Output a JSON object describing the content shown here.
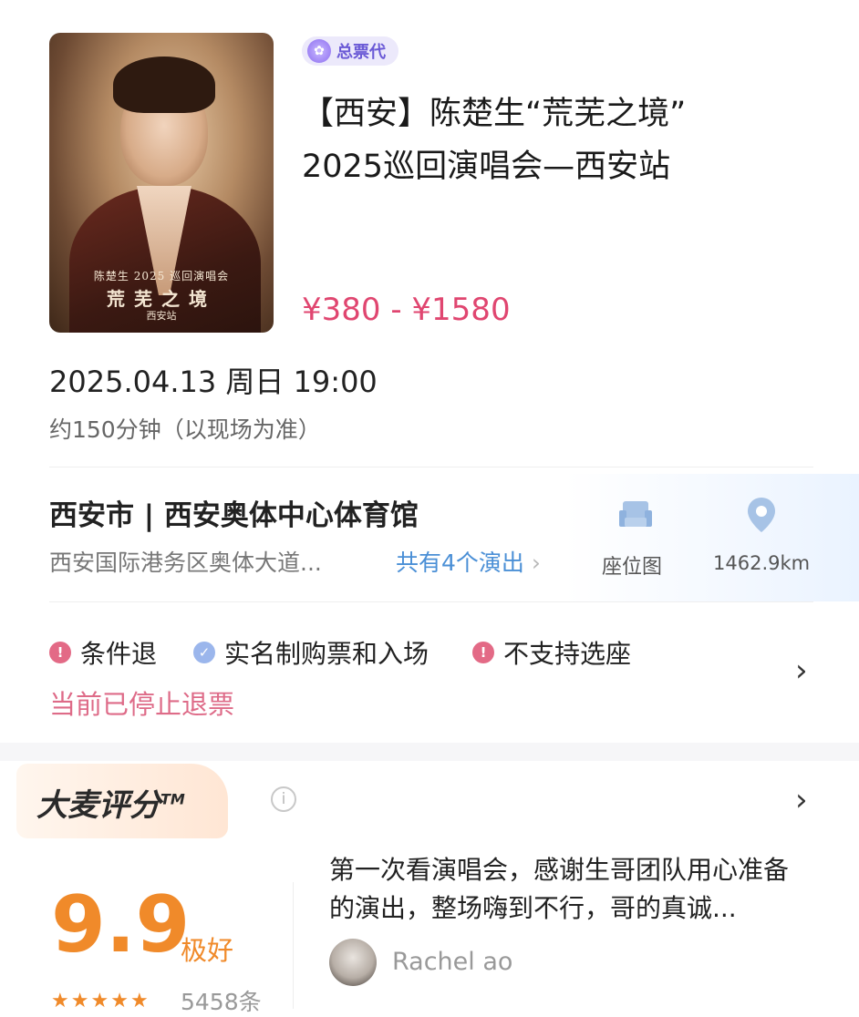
{
  "event": {
    "badge": "总票代",
    "title_line1": "【西安】陈楚生“荒芜之境”",
    "title_line2": "2025巡回演唱会—西安站",
    "price": "¥380 - ¥1580",
    "date": "2025.04.13 周日 19:00",
    "duration": "约150分钟（以现场为准）",
    "poster": {
      "line1": "陈楚生 2025 巡回演唱会",
      "line2": "荒芜之境",
      "line3": "西安站"
    }
  },
  "venue": {
    "title": "西安市 | 西安奥体中心体育馆",
    "address": "西安国际港务区奥体大道...",
    "shows_link": "共有4个演出",
    "seat_map_label": "座位图",
    "distance": "1462.9km"
  },
  "policies": [
    {
      "label": "条件退",
      "icon": "exclamation-icon"
    },
    {
      "label": "实名制购票和入场",
      "icon": "check-icon"
    },
    {
      "label": "不支持选座",
      "icon": "exclamation-icon"
    }
  ],
  "refund_note": "当前已停止退票",
  "rating": {
    "brand": "大麦评分",
    "tm": "TM",
    "score": "9.9",
    "score_label": "极好",
    "stars": 4.5,
    "count": "5458条",
    "review_text": "第一次看演唱会，感谢生哥团队用心准备的演出，整场嗨到不行，哥的真诚...",
    "reviewer": "Rachel ao"
  },
  "colors": {
    "price": "#e04670",
    "link": "#4a8fd6",
    "score": "#f08a2a",
    "warning": "#e36a86"
  }
}
